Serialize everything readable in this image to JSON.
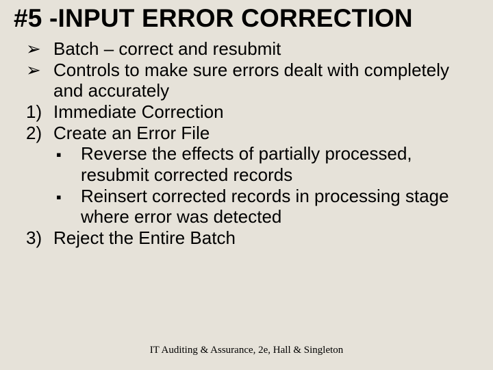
{
  "title": "#5 -INPUT ERROR CORRECTION",
  "bullets": {
    "b1": "Batch – correct and resubmit",
    "b2": "Controls to make sure errors dealt with completely and accurately",
    "n1": "Immediate Correction",
    "n2": "Create an Error File",
    "s1": "Reverse the effects of partially processed, resubmit corrected records",
    "s2": "Reinsert corrected records in processing stage where error was detected",
    "n3": "Reject the Entire Batch"
  },
  "markers": {
    "arrow": "➢",
    "square": "▪",
    "num1": "1)",
    "num2": "2)",
    "num3": "3)"
  },
  "footer": "IT Auditing & Assurance, 2e, Hall & Singleton"
}
